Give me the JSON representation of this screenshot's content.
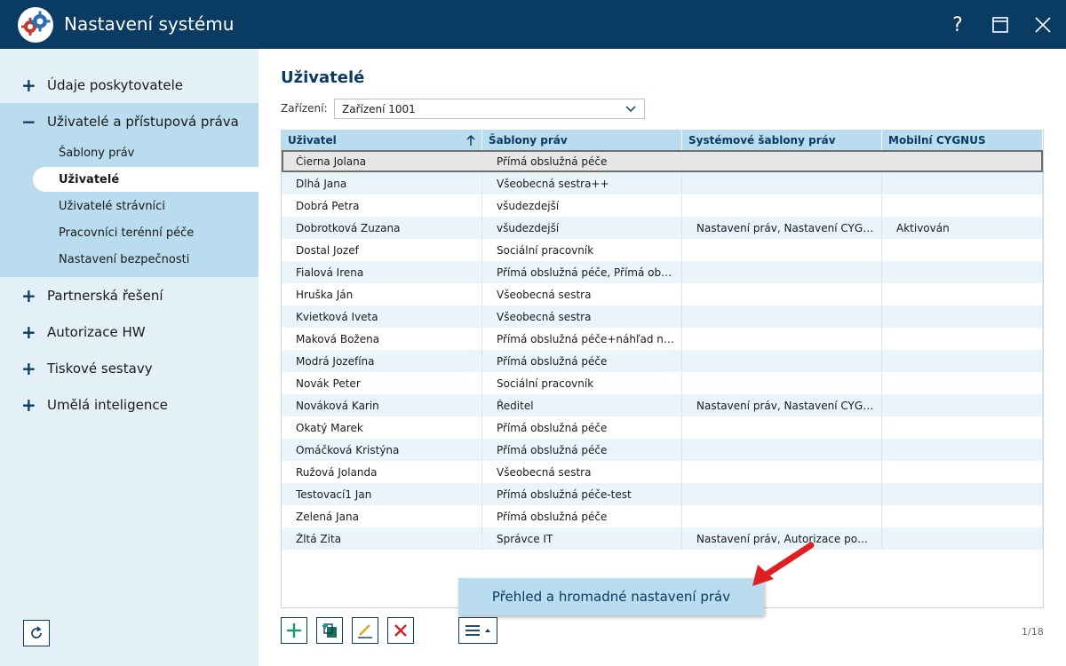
{
  "window": {
    "title": "Nastavení systému",
    "help_label": "?"
  },
  "sidebar": {
    "items": [
      {
        "label": "Údaje poskytovatele",
        "sign": "+"
      },
      {
        "label": "Uživatelé a přístupová práva",
        "sign": "−"
      },
      {
        "label": "Partnerská řešení",
        "sign": "+"
      },
      {
        "label": "Autorizace HW",
        "sign": "+"
      },
      {
        "label": "Tiskové sestavy",
        "sign": "+"
      },
      {
        "label": "Umělá inteligence",
        "sign": "+"
      }
    ],
    "subitems": [
      {
        "label": "Šablony práv"
      },
      {
        "label": "Uživatelé"
      },
      {
        "label": "Uživatelé strávníci"
      },
      {
        "label": "Pracovníci terénní péče"
      },
      {
        "label": "Nastavení bezpečnosti"
      }
    ]
  },
  "main": {
    "title": "Uživatelé",
    "device_label": "Zařízení:",
    "device_value": "Zařízení 1001",
    "columns": [
      "Uživatel",
      "Šablony práv",
      "Systémové šablony práv",
      "Mobilní CYGNUS"
    ],
    "rows": [
      [
        "Čierna Jolana",
        "Přímá obslužná péče",
        "",
        ""
      ],
      [
        "Dlhá Jana",
        "Všeobecná sestra++",
        "",
        ""
      ],
      [
        "Dobrá Petra",
        "všudezdejší",
        "",
        ""
      ],
      [
        "Dobrotková Zuzana",
        "všudezdejší",
        "Nastavení práv, Nastavení CYG…",
        "Aktivován"
      ],
      [
        "Dostal Jozef",
        "Sociální pracovník",
        "",
        ""
      ],
      [
        "Fialová Irena",
        "Přímá obslužná péče, Přímá ob…",
        "",
        ""
      ],
      [
        "Hruška Ján",
        "Všeobecná sestra",
        "",
        ""
      ],
      [
        "Kvietková Iveta",
        "Všeobecná sestra",
        "",
        ""
      ],
      [
        "Maková Božena",
        "Přímá obslužná péče+náhľad n…",
        "",
        ""
      ],
      [
        "Modrá Jozefína",
        "Přímá obslužná péče",
        "",
        ""
      ],
      [
        "Novák Peter",
        "Sociální pracovník",
        "",
        ""
      ],
      [
        "Nováková Karin",
        "Ředitel",
        "Nastavení práv, Nastavení CYG…",
        ""
      ],
      [
        "Okatý Marek",
        "Přímá obslužná péče",
        "",
        ""
      ],
      [
        "Omáčková Kristýna",
        "Přímá obslužná péče",
        "",
        ""
      ],
      [
        "Ružová Jolanda",
        "Všeobecná sestra",
        "",
        ""
      ],
      [
        "Testovací1 Jan",
        "Přímá obslužná péče-test",
        "",
        ""
      ],
      [
        "Zelená Jana",
        "Přímá obslužná péče",
        "",
        ""
      ],
      [
        "Žltá Zita",
        "Správce IT",
        "Nastavení práv, Autorizace po…",
        ""
      ]
    ],
    "popup_label": "Přehled a hromadné nastavení práv",
    "counter": "1/18"
  },
  "colors": {
    "titlebar": "#0a3b63",
    "sidebar_bg": "#e3f0f8",
    "accent_light": "#b9dcee",
    "add_green": "#1a9a6e",
    "delete_red": "#d0202a",
    "arrow_red": "#e02020"
  },
  "icons": [
    "app-logo-gears-icon",
    "help-icon",
    "maximize-icon",
    "close-icon",
    "refresh-icon",
    "plus-icon",
    "copy-add-icon",
    "edit-icon",
    "delete-icon",
    "menu-icon",
    "sort-up-icon",
    "chevron-down-icon"
  ]
}
